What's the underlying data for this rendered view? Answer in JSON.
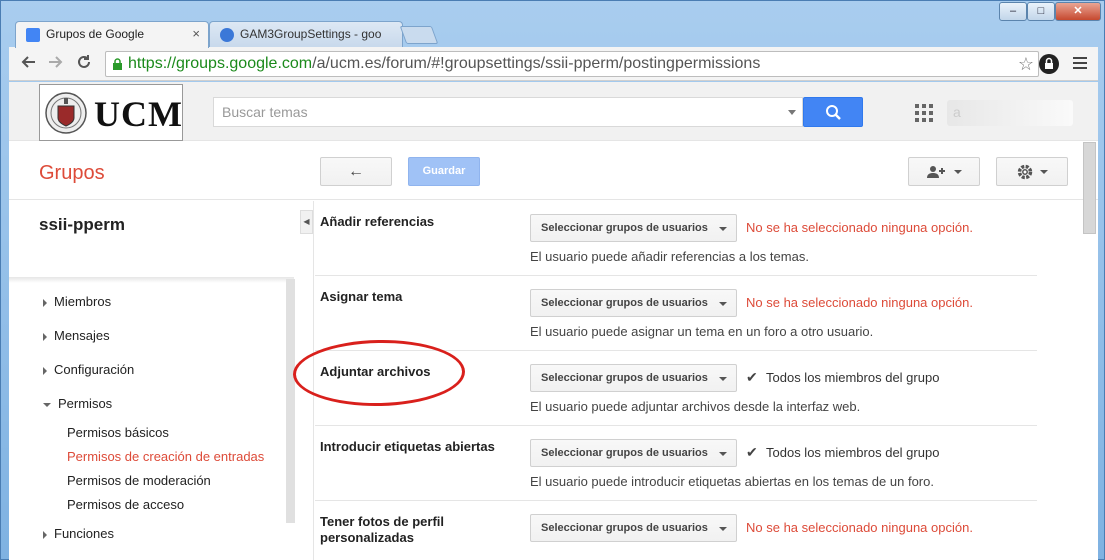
{
  "browser": {
    "tabs": [
      {
        "title": "Grupos de Google",
        "close": "×"
      },
      {
        "title": "GAM3GroupSettings - goo"
      }
    ],
    "url_scheme": "https://",
    "url_host": "groups.google.com",
    "url_path": "/a/ucm.es/forum/#!groupsettings/ssii-pperm/postingpermissions",
    "window_buttons": [
      "–",
      "□",
      "✕"
    ]
  },
  "header": {
    "logo_text": "UCM",
    "search_placeholder": "Buscar temas",
    "account": "a"
  },
  "appbar": {
    "title": "Grupos",
    "back_icon": "←",
    "save_label": "Guardar"
  },
  "sidebar": {
    "group_name": "ssii-pperm",
    "collapse_icon": "◀",
    "items": [
      {
        "label": "Miembros"
      },
      {
        "label": "Mensajes"
      },
      {
        "label": "Configuración"
      },
      {
        "label": "Permisos"
      },
      {
        "label": "Funciones"
      }
    ],
    "sub_items": [
      {
        "label": "Permisos básicos"
      },
      {
        "label": "Permisos de creación de entradas"
      },
      {
        "label": "Permisos de moderación"
      },
      {
        "label": "Permisos de acceso"
      }
    ]
  },
  "settings": {
    "select_label": "Seleccionar grupos de usuarios",
    "check_icon": "✔",
    "rows": [
      {
        "label": "Añadir referencias",
        "status": "No se ha seleccionado ninguna opción.",
        "desc": "El usuario puede añadir referencias a los temas."
      },
      {
        "label": "Asignar tema",
        "status": "No se ha seleccionado ninguna opción.",
        "desc": "El usuario puede asignar un tema en un foro a otro usuario."
      },
      {
        "label": "Adjuntar archivos",
        "status": "Todos los miembros del grupo",
        "desc": "El usuario puede adjuntar archivos desde la interfaz web."
      },
      {
        "label": "Introducir etiquetas abiertas",
        "status": "Todos los miembros del grupo",
        "desc": "El usuario puede introducir etiquetas abiertas en los temas de un foro."
      },
      {
        "label": "Tener fotos de perfil personalizadas",
        "status": "No se ha seleccionado ninguna opción.",
        "desc": ""
      }
    ]
  },
  "colors": {
    "accent_red": "#dd4b39",
    "search_blue": "#4285f4",
    "url_green": "#1b8a1b",
    "annotation_red": "#d9201c"
  }
}
